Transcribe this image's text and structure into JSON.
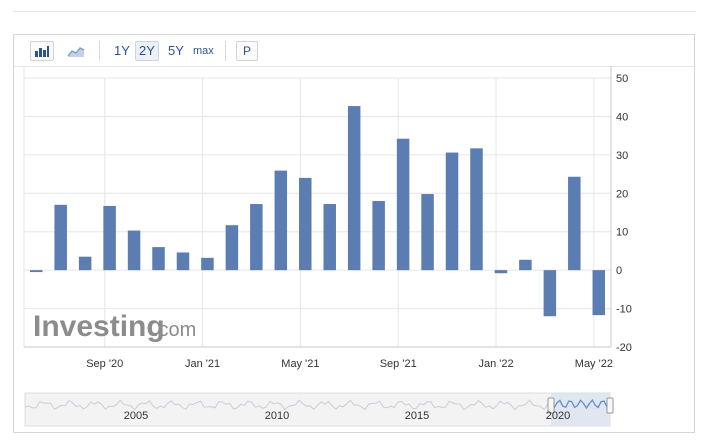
{
  "toolbar": {
    "ranges": [
      "1Y",
      "2Y",
      "5Y",
      "max"
    ],
    "active_range": "2Y",
    "p_label": "P"
  },
  "watermark": {
    "brand": "Investing",
    "suffix": ".com"
  },
  "colors": {
    "bar": "#5b7db1",
    "grid": "#e6e6e6",
    "axis": "#c8c8c8",
    "navigator_line": "#5b8bc9"
  },
  "chart_data": {
    "type": "bar",
    "title": "",
    "xlabel": "",
    "ylabel": "",
    "ylim": [
      -20,
      50
    ],
    "y_ticks": [
      50,
      40,
      30,
      20,
      10,
      0,
      -10,
      -20
    ],
    "values": [
      -0.5,
      17,
      3.5,
      16.7,
      10.3,
      6,
      4.6,
      3.2,
      11.7,
      17.2,
      25.9,
      24,
      17.2,
      42.7,
      18,
      34.2,
      19.8,
      30.6,
      31.7,
      -0.8,
      2.7,
      -12,
      24.3,
      -11.7
    ],
    "x_tick_labels": [
      {
        "label": "Sep '20",
        "index": 2.8
      },
      {
        "label": "Jan '21",
        "index": 6.8
      },
      {
        "label": "May '21",
        "index": 10.8
      },
      {
        "label": "Sep '21",
        "index": 14.8
      },
      {
        "label": "Jan '22",
        "index": 18.8
      },
      {
        "label": "May '22",
        "index": 22.8
      }
    ],
    "grid": true,
    "y_axis_position": "right",
    "navigator": {
      "year_labels": [
        "2005",
        "2010",
        "2015",
        "2020"
      ]
    }
  }
}
